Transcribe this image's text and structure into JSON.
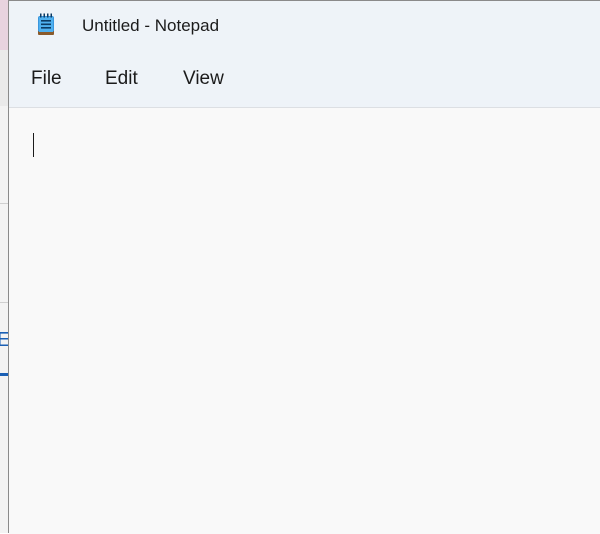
{
  "background_window": {
    "partial_text": "E",
    "accent_color": "#1a5fb4"
  },
  "window": {
    "title": "Untitled - Notepad",
    "icon": "notepad-icon"
  },
  "menu": {
    "items": [
      {
        "label": "File"
      },
      {
        "label": "Edit"
      },
      {
        "label": "View"
      }
    ]
  },
  "editor": {
    "content": ""
  }
}
